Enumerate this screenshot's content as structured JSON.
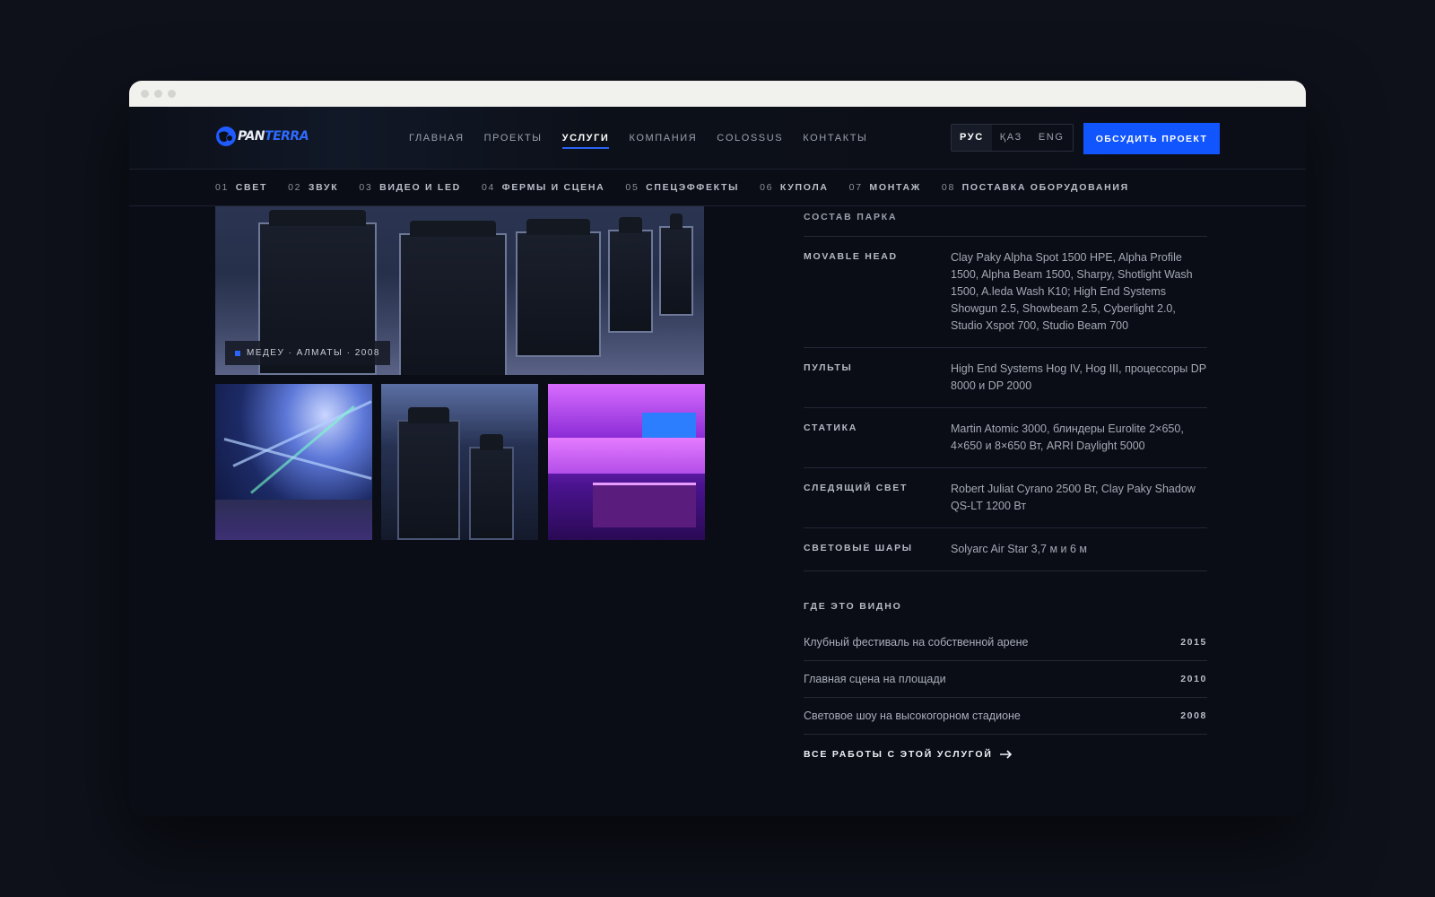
{
  "logo": {
    "brand_a": "PAN",
    "brand_b": "TERRA"
  },
  "nav": {
    "items": [
      {
        "label": "ГЛАВНАЯ",
        "active": false
      },
      {
        "label": "ПРОЕКТЫ",
        "active": false
      },
      {
        "label": "УСЛУГИ",
        "active": true
      },
      {
        "label": "КОМПАНИЯ",
        "active": false
      },
      {
        "label": "COLOSSUS",
        "active": false
      },
      {
        "label": "КОНТАКТЫ",
        "active": false
      }
    ]
  },
  "lang": {
    "items": [
      "РУС",
      "ҚАЗ",
      "ENG"
    ],
    "active": "РУС"
  },
  "cta": {
    "label": "ОБСУДИТЬ ПРОЕКТ"
  },
  "subnav": {
    "items": [
      {
        "num": "01",
        "label": "СВЕТ"
      },
      {
        "num": "02",
        "label": "ЗВУК"
      },
      {
        "num": "03",
        "label": "ВИДЕО И LED"
      },
      {
        "num": "04",
        "label": "ФЕРМЫ И СЦЕНА"
      },
      {
        "num": "05",
        "label": "СПЕЦЭФФЕКТЫ"
      },
      {
        "num": "06",
        "label": "КУПОЛА"
      },
      {
        "num": "07",
        "label": "МОНТАЖ"
      },
      {
        "num": "08",
        "label": "ПОСТАВКА ОБОРУДОВАНИЯ"
      }
    ]
  },
  "gallery": {
    "hero_caption": "МЕДЕУ · АЛМАТЫ · 2008"
  },
  "specs": {
    "heading": "СОСТАВ ПАРКА",
    "rows": [
      {
        "label": "MOVABLE HEAD",
        "value": "Clay Paky Alpha Spot 1500 HPE, Alpha Profile 1500, Alpha Beam 1500, Sharpy, Shotlight Wash 1500, A.leda Wash K10; High End Systems Showgun 2.5, Showbeam 2.5, Cyberlight 2.0, Studio Xspot 700, Studio Beam 700"
      },
      {
        "label": "ПУЛЬТЫ",
        "value": "High End Systems Hog IV, Hog III, процессоры DP 8000 и DP 2000"
      },
      {
        "label": "СТАТИКА",
        "value": "Martin Atomic 3000, блиндеры Eurolite 2×650, 4×650 и 8×650 Вт, ARRI Daylight 5000"
      },
      {
        "label": "СЛЕДЯЩИЙ СВЕТ",
        "value": "Robert Juliat Cyrano 2500 Вт, Clay Paky Shadow QS-LT 1200 Вт"
      },
      {
        "label": "СВЕТОВЫЕ ШАРЫ",
        "value": "Solyarc Air Star 3,7 м и 6 м"
      }
    ]
  },
  "seen": {
    "heading": "ГДЕ ЭТО ВИДНО",
    "rows": [
      {
        "title": "Клубный фестиваль на собственной арене",
        "year": "2015"
      },
      {
        "title": "Главная сцена на площади",
        "year": "2010"
      },
      {
        "title": "Световое шоу на высокогорном стадионе",
        "year": "2008"
      }
    ],
    "all_link": "ВСЕ РАБОТЫ С ЭТОЙ УСЛУГОЙ"
  },
  "colors": {
    "accent": "#1155ff",
    "background": "#0a0d15"
  }
}
